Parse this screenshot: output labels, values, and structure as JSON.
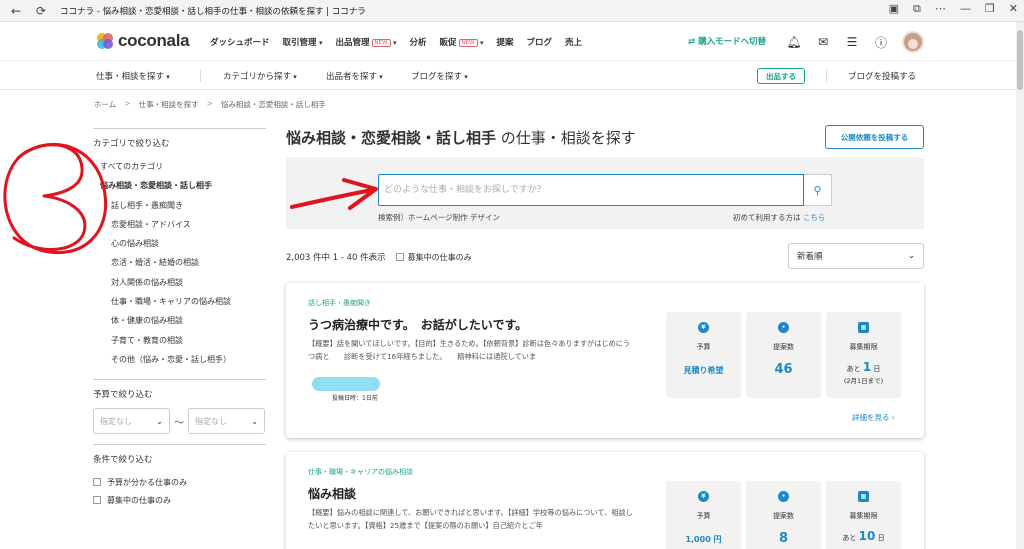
{
  "browser": {
    "title": "ココナラ - 悩み相談・恋愛相談・話し相手の仕事・相談の依頼を探す | ココナラ"
  },
  "header": {
    "logo_text": "coconala",
    "nav": [
      {
        "label": "ダッシュボード"
      },
      {
        "label": "取引管理"
      },
      {
        "label": "出品管理",
        "badge": "NEW"
      },
      {
        "label": "分析"
      },
      {
        "label": "販促",
        "badge": "NEW"
      },
      {
        "label": "提案"
      },
      {
        "label": "ブログ"
      },
      {
        "label": "売上"
      }
    ],
    "buy_mode": "購入モードへ切替"
  },
  "subnav": {
    "items": [
      "仕事・相談を探す",
      "カテゴリから探す",
      "出品者を探す",
      "ブログを探す"
    ],
    "sell_button": "出品する",
    "post_blog": "ブログを投稿する"
  },
  "breadcrumb": [
    "ホーム",
    "仕事・相談を探す",
    "悩み相談・恋愛相談・話し相手"
  ],
  "sidebar": {
    "category_head": "カテゴリで絞り込む",
    "all_categories": "すべてのカテゴリ",
    "current": "悩み相談・恋愛相談・話し相手",
    "items": [
      "話し相手・愚痴聞き",
      "恋愛相談・アドバイス",
      "心の悩み相談",
      "恋活・婚活・結婚の相談",
      "対人関係の悩み相談",
      "仕事・職場・キャリアの悩み相談",
      "体・健康の悩み相談",
      "子育て・教育の相談",
      "その他（悩み・恋愛・話し相手）"
    ],
    "budget_head": "予算で絞り込む",
    "budget_min": "指定なし",
    "budget_max": "指定なし",
    "tilde": "〜",
    "condition_head": "条件で絞り込む",
    "conditions": [
      "予算が分かる仕事のみ",
      "募集中の仕事のみ"
    ]
  },
  "main": {
    "title_bold": "悩み相談・恋愛相談・話し相手",
    "title_rest": " の仕事・相談を探す",
    "post_button": "公開依頼を投稿する",
    "search_placeholder": "どのような仕事・相談をお探しですか？",
    "search_example": "検索例）ホームページ制作  デザイン",
    "first_time": "初めて利用する方は ",
    "first_time_link": "こちら",
    "result_count": "2,003 件中 1 - 40 件表示",
    "recruiting_only": "募集中の仕事のみ",
    "sort": "新着順"
  },
  "cards": [
    {
      "category": "話し相手・愚痴聞き",
      "title": "うつ病治療中です。　お話がしたいです。",
      "desc": "【概要】話を聞いてほしいです。【目的】生きるため。【依頼背景】診断は色々ありますがはじめにうつ病と　　診断を受けて16年経ちました。　　精神科には通院していま",
      "date": "投稿日時：1日前",
      "budget_label": "予算",
      "budget_value": "見積り希望",
      "proposals_label": "提案数",
      "proposals_value": "46",
      "deadline_label": "募集期限",
      "deadline_prefix": "あと",
      "deadline_num": "1",
      "deadline_unit": "日",
      "deadline_date": "(2月1日まで)",
      "more": "詳細を見る"
    },
    {
      "category": "仕事・職場・キャリアの悩み相談",
      "title": "悩み相談",
      "desc": "【概要】悩みの相談に関連して、お願いできればと思います。【詳細】学校等の悩みについて、相談したいと思います。【資格】25歳まで【提案の際のお願い】自己紹介とご年",
      "budget_label": "予算",
      "budget_value": "1,000 円",
      "proposals_label": "提案数",
      "proposals_value": "8",
      "deadline_label": "募集期限",
      "deadline_prefix": "あと",
      "deadline_num": "10",
      "deadline_unit": "日"
    }
  ],
  "annotation": {
    "mark": "③"
  },
  "colors": {
    "brand_green": "#1aa38b",
    "link_blue": "#1e88c7",
    "annotation_red": "#e0141e"
  }
}
